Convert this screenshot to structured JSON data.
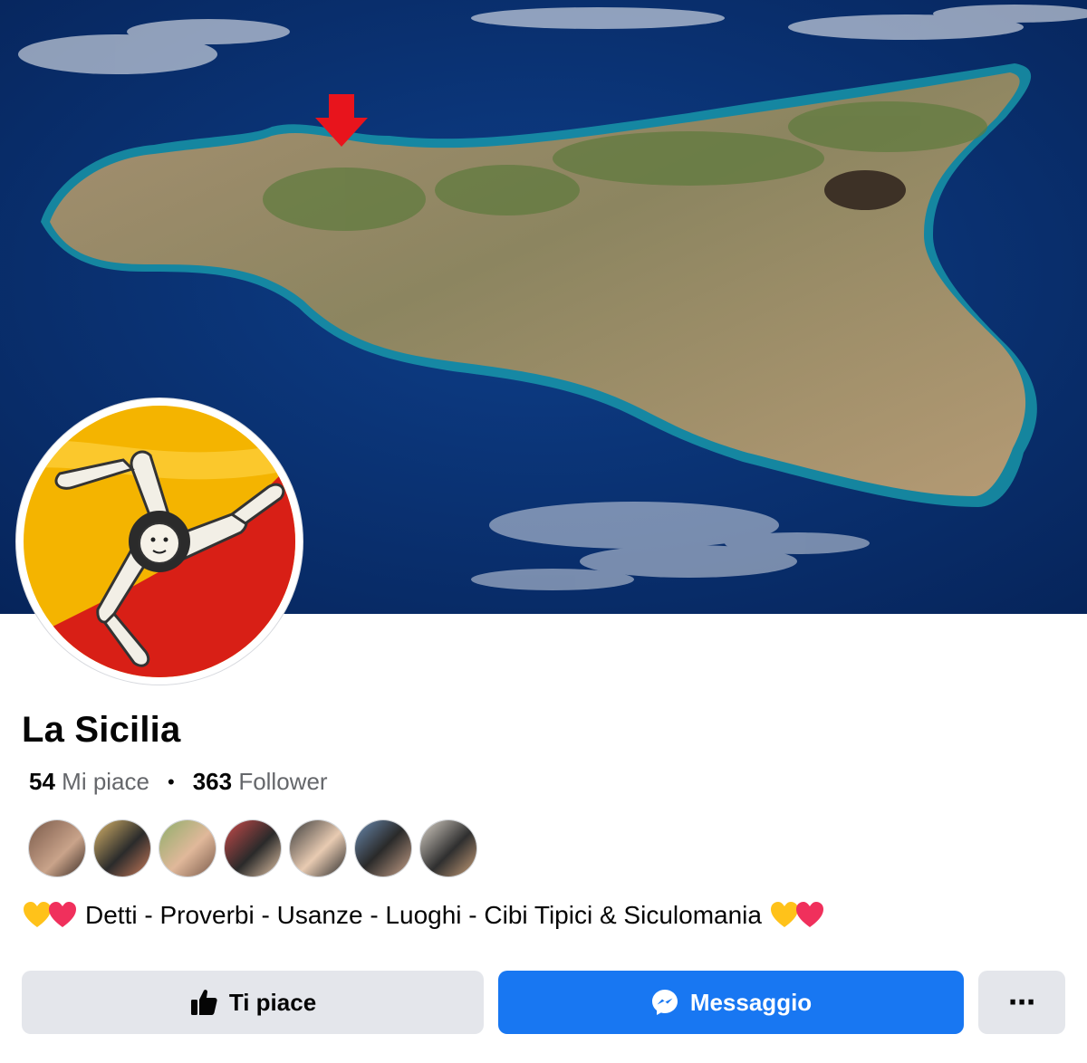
{
  "page": {
    "name": "La Sicilia",
    "likes_count": "54",
    "likes_label": "Mi piace",
    "separator": "•",
    "followers_count": "363",
    "followers_label": "Follower",
    "bio": "Detti - Proverbi - Usanze - Luoghi - Cibi Tipici & Siculomania"
  },
  "buttons": {
    "like_label": "Ti piace",
    "message_label": "Messaggio",
    "more_label": "⋯"
  },
  "colors": {
    "primary": "#1877f2",
    "secondary_bg": "#e4e6eb",
    "text": "#050505",
    "muted": "#65676b"
  },
  "icons": {
    "like": "thumbs-up-icon",
    "message": "messenger-icon",
    "more": "more-icon",
    "bio_emoji": "yellow-heart-and-pink-heart"
  }
}
